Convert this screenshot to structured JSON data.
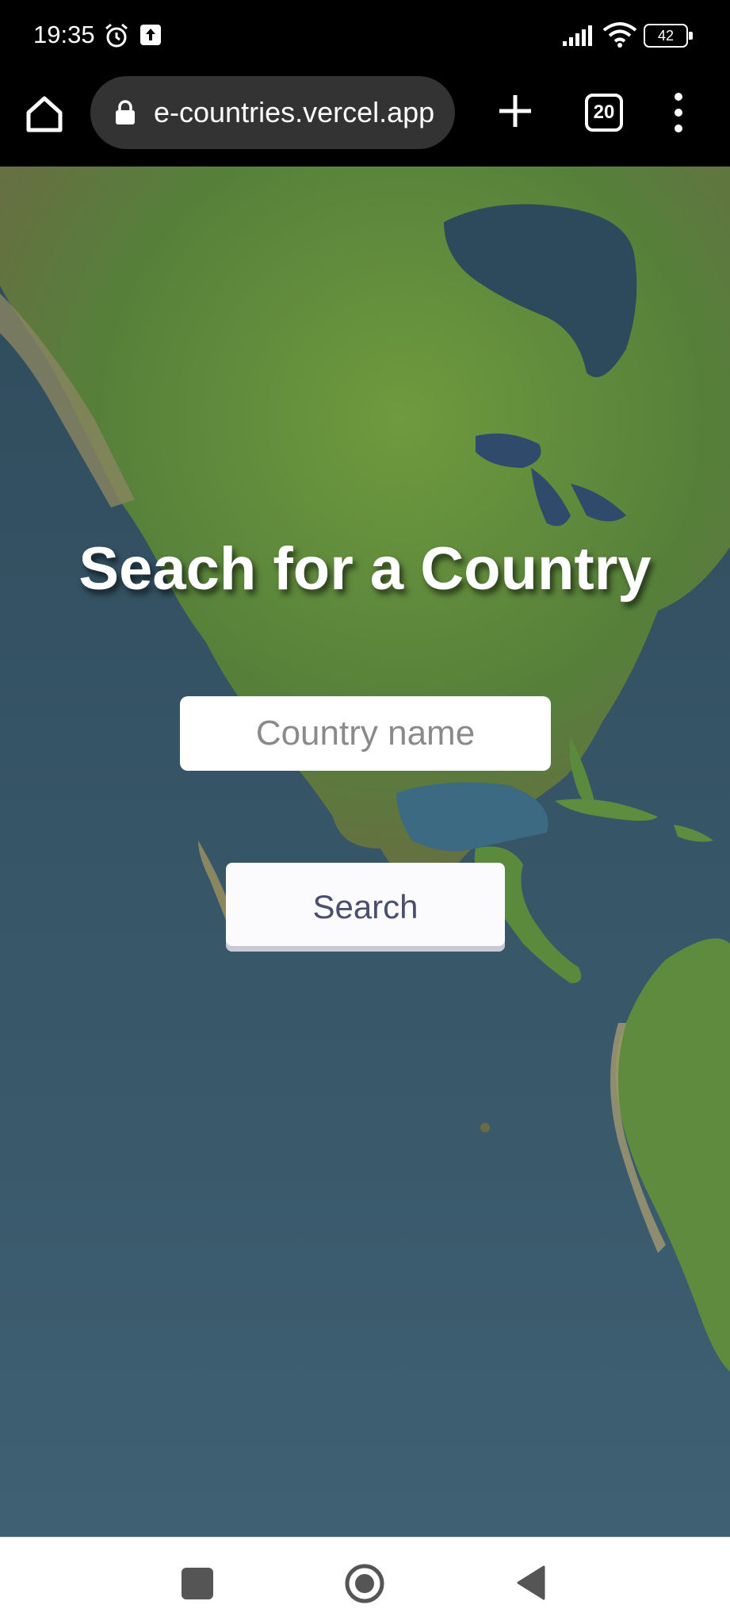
{
  "status_bar": {
    "time": "19:35",
    "battery": "42",
    "icons": [
      "alarm-icon",
      "upload-icon",
      "signal-icon",
      "wifi-icon",
      "battery-icon"
    ]
  },
  "browser": {
    "url": "e-countries.vercel.app",
    "tab_count": "20",
    "icons": [
      "home-icon",
      "lock-icon",
      "plus-icon",
      "more-vert-icon"
    ]
  },
  "page": {
    "title": "Seach for a Country",
    "input_placeholder": "Country name",
    "input_value": "",
    "search_label": "Search"
  },
  "nav_bar": {
    "icons": [
      "recent-apps-icon",
      "home-circle-icon",
      "back-icon"
    ]
  },
  "colors": {
    "ocean": "#3b5a6e",
    "land_green": "#5e8a3a",
    "button_text": "#4a4f6e",
    "placeholder": "#8a8a8a"
  }
}
